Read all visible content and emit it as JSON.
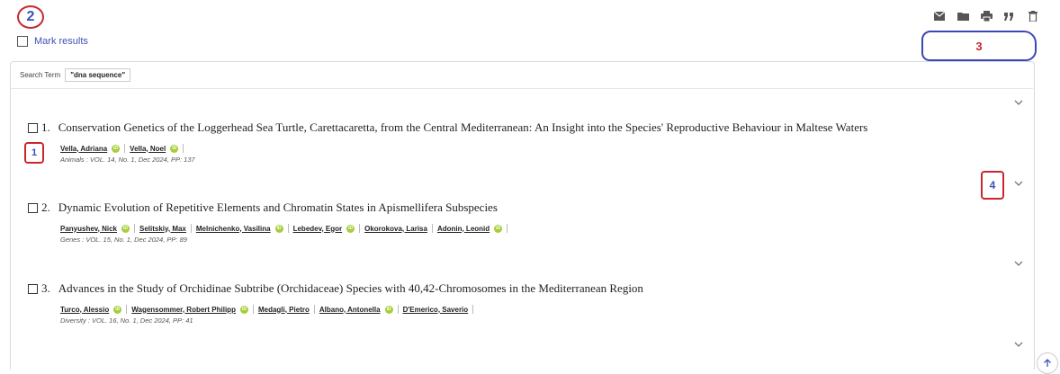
{
  "annotations": {
    "marker_1": "1",
    "marker_2": "2",
    "marker_3": "3",
    "marker_4": "4"
  },
  "toolbar": {
    "icons": [
      "email-icon",
      "folder-icon",
      "print-icon",
      "quote-icon",
      "delete-icon"
    ]
  },
  "mark_results": {
    "label": "Mark results"
  },
  "search": {
    "label": "Search Term",
    "value": "\"dna sequence\""
  },
  "results": [
    {
      "number": "1.",
      "title": "Conservation Genetics of the Loggerhead Sea Turtle, Carettacaretta, from the Central Mediterranean: An Insight into the Species' Reproductive Behaviour in Maltese Waters",
      "authors": [
        {
          "name": "Vella, Adriana",
          "orcid": true
        },
        {
          "name": "Vella, Noel",
          "orcid": true
        }
      ],
      "source": "Animals : VOL. 14, No. 1, Dec 2024, PP: 137"
    },
    {
      "number": "2.",
      "title": "Dynamic Evolution of Repetitive Elements and Chromatin States in Apismellifera Subspecies",
      "authors": [
        {
          "name": "Panyushev, Nick",
          "orcid": true
        },
        {
          "name": "Selitskiy, Max",
          "orcid": false
        },
        {
          "name": "Melnichenko, Vasilina",
          "orcid": true
        },
        {
          "name": "Lebedev, Egor",
          "orcid": true
        },
        {
          "name": "Okorokova, Larisa",
          "orcid": false
        },
        {
          "name": "Adonin, Leonid",
          "orcid": true
        }
      ],
      "source": "Genes : VOL. 15, No. 1, Dec 2024, PP: 89"
    },
    {
      "number": "3.",
      "title": "Advances in the Study of Orchidinae Subtribe (Orchidaceae) Species with 40,42-Chromosomes in the Mediterranean Region",
      "authors": [
        {
          "name": "Turco, Alessio",
          "orcid": true
        },
        {
          "name": "Wagensommer, Robert Philipp",
          "orcid": true
        },
        {
          "name": "Medagli, Pietro",
          "orcid": false
        },
        {
          "name": "Albano, Antonella",
          "orcid": true
        },
        {
          "name": "D'Emerico, Saverio",
          "orcid": false
        }
      ],
      "source": "Diversity : VOL. 16, No. 1, Dec 2024, PP: 41"
    }
  ],
  "orcid_badge": "iD"
}
